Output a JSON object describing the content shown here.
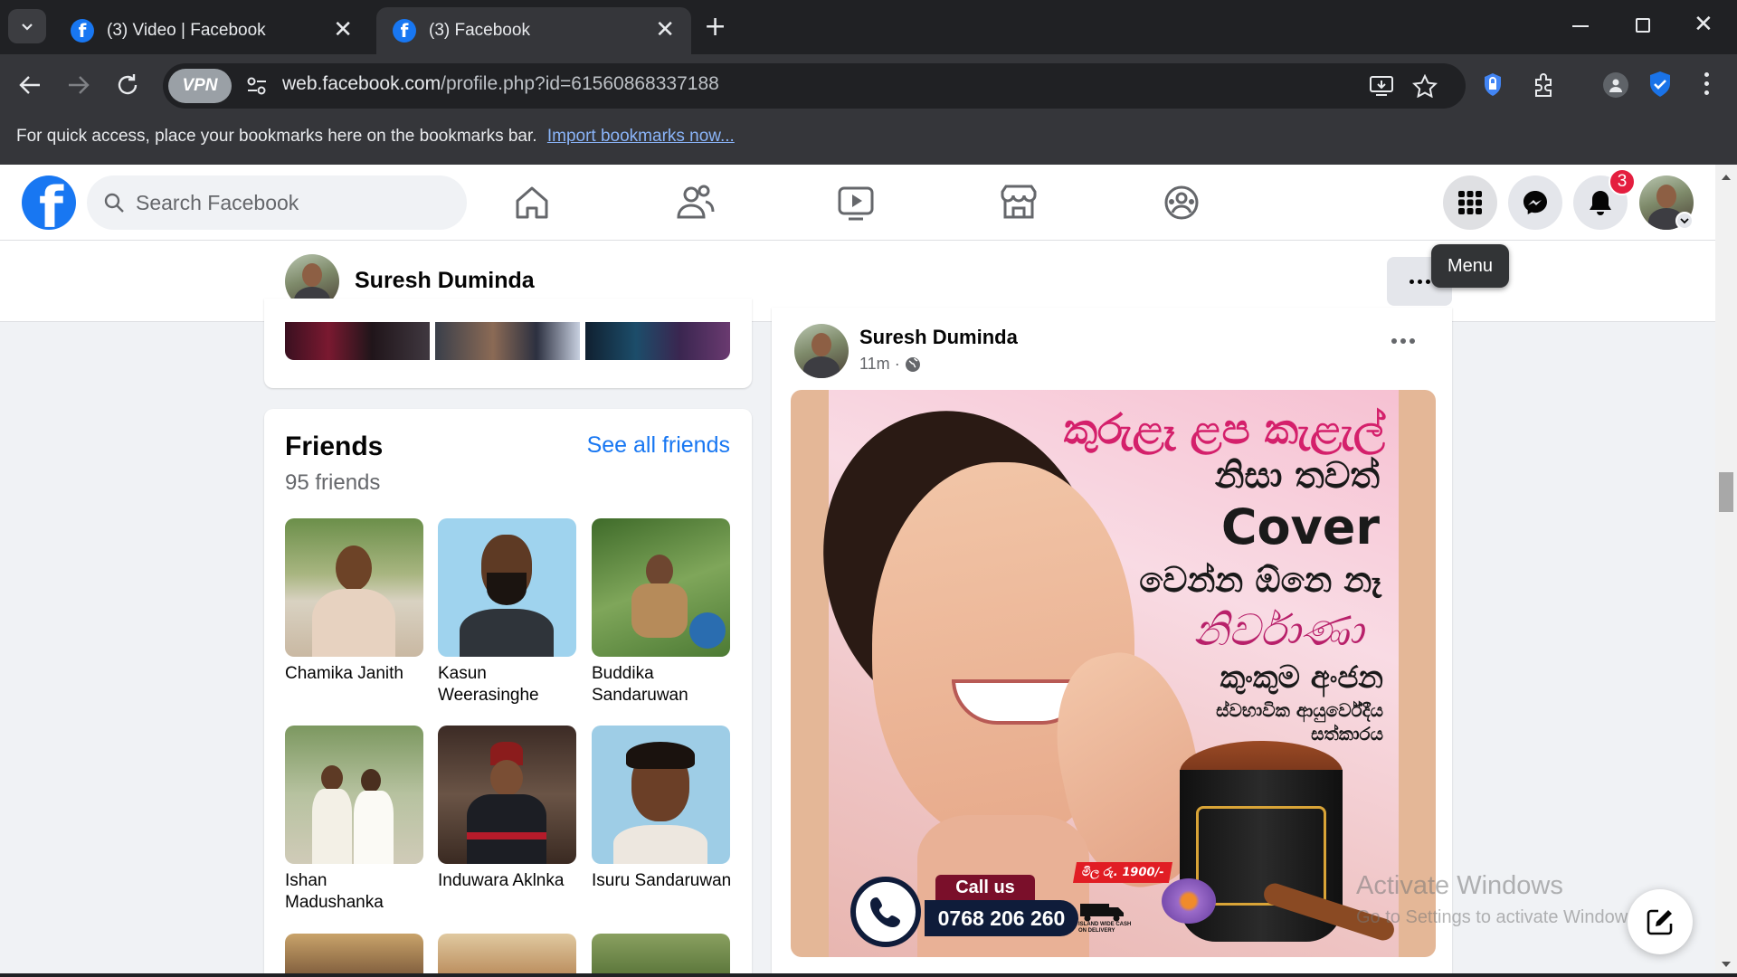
{
  "browser": {
    "tabs": [
      {
        "title": "(3) Video | Facebook",
        "active": false
      },
      {
        "title": "(3) Facebook",
        "active": true
      }
    ],
    "address": {
      "domain": "web.facebook.com",
      "path": "/profile.php?id=61560868337188"
    },
    "vpn_label": "VPN",
    "bookmarks_message": "For quick access, place your bookmarks here on the bookmarks bar.",
    "bookmarks_link": "Import bookmarks now..."
  },
  "fb": {
    "search_placeholder": "Search Facebook",
    "notification_count": "3",
    "tooltip": "Menu",
    "brand_color": "#1877f2"
  },
  "profile": {
    "name": "Suresh Duminda"
  },
  "friends": {
    "title": "Friends",
    "see_all": "See all friends",
    "count_text": "95 friends",
    "list": [
      {
        "name": "Chamika Janith"
      },
      {
        "name": "Kasun Weerasinghe"
      },
      {
        "name": "Buddika Sandaruwan"
      },
      {
        "name": "Ishan Madushanka"
      },
      {
        "name": "Induwara Aklnka"
      },
      {
        "name": "Isuru Sandaruwan"
      }
    ]
  },
  "post": {
    "author": "Suresh Duminda",
    "time": "11m",
    "ad": {
      "line1": "කුරුළෑ ළප කැළැල්",
      "line2": "නිසා තවත්",
      "line3": "Cover",
      "line4": "වෙන්න ඕනෙ නෑ",
      "brand": "නිර්වාණා",
      "line5": "කුංකුම අංජන",
      "line6": "ස්වභාවික ආයුර්වේදීය",
      "line7": "සත්කාරය",
      "price": "මිල රු. 1900/-",
      "call_us": "Call us",
      "phone": "0768 206 260",
      "delivery": "ISLAND WIDE CASH ON DELIVERY"
    }
  },
  "windows": {
    "watermark_title": "Activate Windows",
    "watermark_sub": "Go to Settings to activate Windows."
  }
}
